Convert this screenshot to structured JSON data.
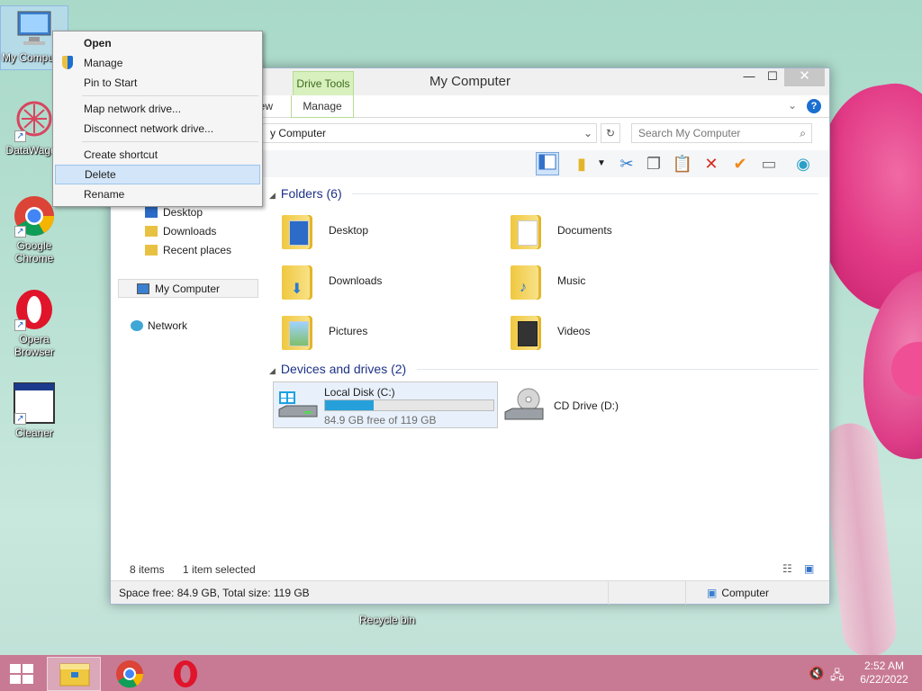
{
  "desktop": {
    "icons": [
      {
        "label": "My Computer"
      },
      {
        "label": "DataWagon"
      },
      {
        "label": "Google Chrome"
      },
      {
        "label": "Opera Browser"
      },
      {
        "label": "Cleaner"
      },
      {
        "label": "Recycle bin"
      }
    ]
  },
  "window": {
    "title": "My Computer",
    "context_tab": "Drive Tools",
    "ribbon_tabs": [
      "iew",
      "Manage"
    ],
    "address": "y Computer",
    "search_placeholder": "Search My Computer",
    "nav": {
      "items": [
        "Desktop",
        "Downloads",
        "Recent places"
      ],
      "computer": "My Computer",
      "network": "Network"
    },
    "groups": {
      "folders": "Folders (6)",
      "devices": "Devices and drives (2)"
    },
    "folders": [
      "Desktop",
      "Documents",
      "Downloads",
      "Music",
      "Pictures",
      "Videos"
    ],
    "drive_c": {
      "name": "Local Disk (C:)",
      "free_text": "84.9 GB free of 119 GB",
      "used_fraction": 0.287
    },
    "drive_d": {
      "name": "CD Drive (D:)"
    },
    "status": {
      "count": "8 items",
      "selection": "1 item selected"
    },
    "details": {
      "space": "Space free: 84.9 GB, Total size: 119 GB",
      "location": "Computer"
    }
  },
  "context_menu": {
    "items": [
      "Open",
      "Manage",
      "Pin to Start",
      "Map network drive...",
      "Disconnect network drive...",
      "Create shortcut",
      "Delete",
      "Rename"
    ],
    "highlighted": "Delete"
  },
  "taskbar": {
    "time": "2:52 AM",
    "date": "6/22/2022"
  },
  "colors": {
    "taskbar": "#c87a94",
    "selection": "#d3e5f8",
    "drive_bar": "#26a0da",
    "drive_tools": "#d7f0bd"
  }
}
